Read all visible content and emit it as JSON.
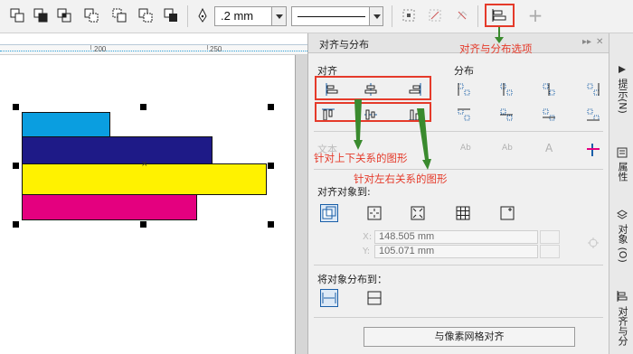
{
  "toolbar": {
    "outline_width": ".2 mm",
    "outline_style": "solid",
    "plus_glyph": "+",
    "icons": [
      "weld-icon",
      "trim-icon",
      "intersect-icon",
      "simplify-icon",
      "front-minus-back-icon",
      "back-minus-front-icon",
      "create-boundary-icon",
      "pen-icon",
      "align-distribute-icon"
    ]
  },
  "ruler": {
    "label_200": "200",
    "label_250": "250"
  },
  "canvas": {
    "shapes": [
      {
        "name": "cyan-rectangle",
        "color": "#0a9ee0"
      },
      {
        "name": "navy-rectangle",
        "color": "#1e1a87"
      },
      {
        "name": "yellow-rectangle",
        "color": "#fff200"
      },
      {
        "name": "magenta-rectangle",
        "color": "#e4007f"
      }
    ],
    "center_mark": "×"
  },
  "docker": {
    "title": "对齐与分布",
    "align_label": "对齐",
    "distribute_label": "分布",
    "text_label": "文本",
    "align_to_label": "对齐对象到:",
    "x_axis": "X:",
    "y_axis": "Y:",
    "x_value": "148.505 mm",
    "y_value": "105.071 mm",
    "distribute_to_label": "将对象分布到：",
    "pixel_grid_button": "与像素网格对齐",
    "ab_left": "Ab",
    "ab_mid": "Ab",
    "a_text": "A"
  },
  "side_tabs": {
    "hint": "提示(N)",
    "properties": "属性",
    "objects": "对象 (O)",
    "align": "对齐与分"
  },
  "annotations": {
    "option_note": "对齐与分布选项",
    "vertical_note": "针对上下关系的图形",
    "horizontal_note": "针对左右关系的图形"
  },
  "colors": {
    "annotation_red": "#e53a2a",
    "arrow_green": "#3a8a2e"
  }
}
